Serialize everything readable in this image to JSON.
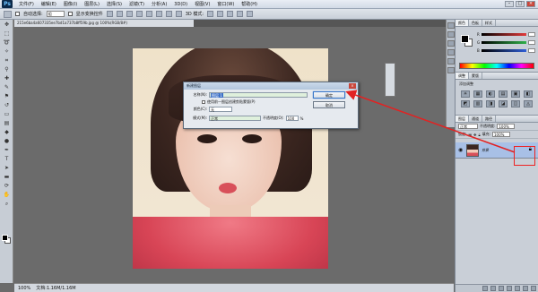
{
  "app": {
    "logo": "Ps"
  },
  "menu": [
    "文件(F)",
    "编辑(E)",
    "图像(I)",
    "图层(L)",
    "选择(S)",
    "滤镜(T)",
    "分析(A)",
    "3D(D)",
    "视图(V)",
    "窗口(W)",
    "帮助(H)"
  ],
  "window_controls": {
    "min": "–",
    "max": "□",
    "close": "×"
  },
  "options": {
    "auto_select_label": "自动选择:",
    "auto_select_value": "组",
    "show_transform_label": "显示变换控件",
    "mode_label": "3D 模式:"
  },
  "document_tab": {
    "title": "215e6ba4a607335ee7bd1a737b8ff59b.jpg @ 100%(RGB/8#)"
  },
  "dialog": {
    "title": "新建图层",
    "close": "×",
    "name_label": "名称(N):",
    "name_value": "图层 1",
    "clip_label": "使用前一图层创建剪贴蒙版(P)",
    "color_label": "颜色(C):",
    "color_value": "无",
    "mode_label": "模式(M):",
    "mode_value": "正常",
    "opacity_label": "不透明度(O):",
    "opacity_value": "100",
    "opacity_unit": "%",
    "ok_label": "确定",
    "cancel_label": "取消"
  },
  "status": {
    "zoom": "100%",
    "doc_info": "文档:1.16M/1.16M"
  },
  "panels": {
    "color_tabs": [
      "颜色",
      "色板",
      "样式"
    ],
    "sliders": [
      {
        "label": "R",
        "color": "#e23b3b"
      },
      {
        "label": "G",
        "color": "#2fb04a"
      },
      {
        "label": "B",
        "color": "#2f5fd6"
      }
    ],
    "adjust_tabs": [
      "调整",
      "蒙版"
    ],
    "adjust_title": "添加调整",
    "adjust_icons": [
      "☀",
      "▦",
      "◐",
      "▤",
      "▣",
      "◧",
      "◩",
      "▥",
      "◨",
      "◪",
      "◫",
      "◬"
    ],
    "layers_tabs": [
      "图层",
      "通道",
      "路径"
    ],
    "blend_value": "正常",
    "opacity_label": "不透明度:",
    "opacity_value": "100%",
    "lock_label": "锁定:",
    "fill_label": "填充:",
    "fill_value": "100%",
    "layer_name": "背景",
    "highlight_color": "#e22222"
  }
}
